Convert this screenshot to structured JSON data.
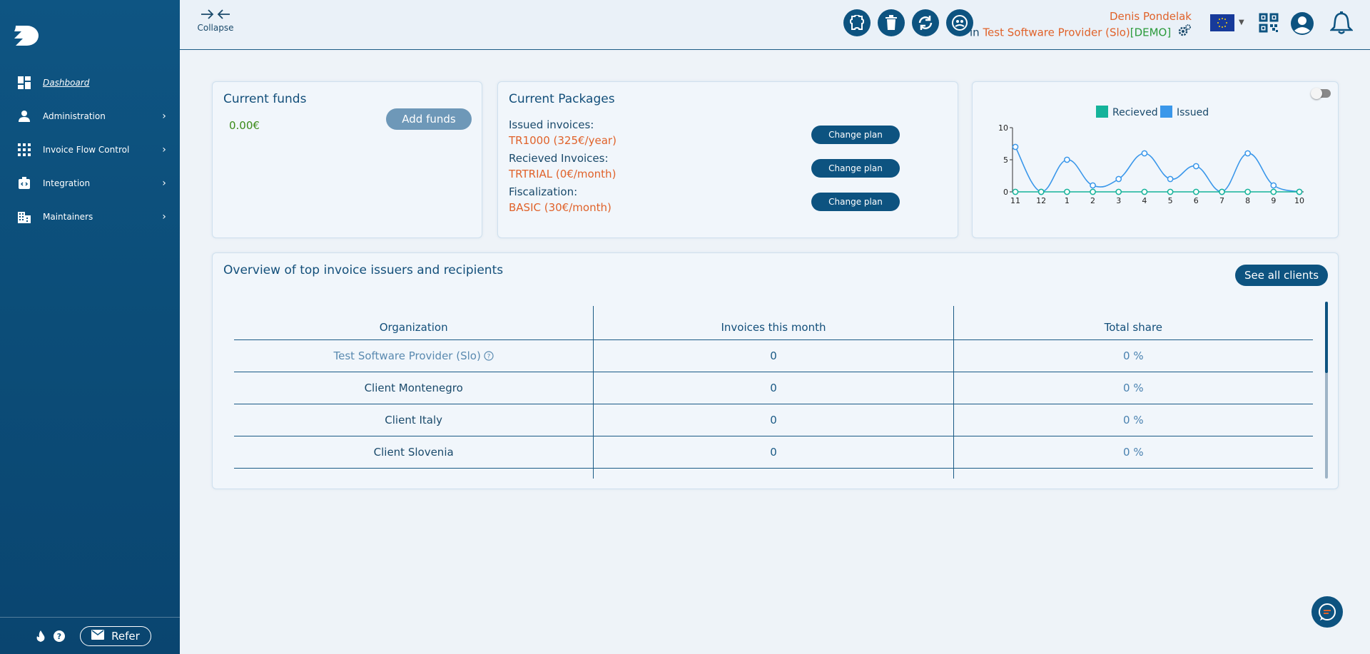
{
  "sidebar": {
    "items": [
      {
        "label": "Dashboard",
        "icon": "dashboard-icon"
      },
      {
        "label": "Administration",
        "icon": "person-icon"
      },
      {
        "label": "Invoice Flow Control",
        "icon": "grid-icon"
      },
      {
        "label": "Integration",
        "icon": "integration-icon"
      },
      {
        "label": "Maintainers",
        "icon": "building-icon"
      }
    ],
    "refer_label": "Refer"
  },
  "topbar": {
    "collapse_label": "Collapse",
    "user_name": "Denis Pondelak",
    "org_prefix": "in",
    "org_name": "Test Software Provider (Slo)",
    "org_tag": "[DEMO]"
  },
  "funds": {
    "title": "Current funds",
    "amount": "0.00€",
    "add_label": "Add funds"
  },
  "packages": {
    "title": "Current Packages",
    "items": [
      {
        "label": "Issued invoices:",
        "value": "TR1000 (325€/year)",
        "button": "Change plan"
      },
      {
        "label": "Recieved Invoices:",
        "value": "TRTRIAL (0€/month)",
        "button": "Change plan"
      },
      {
        "label": "Fiscalization:",
        "value": "BASIC (30€/month)",
        "button": "Change plan"
      }
    ]
  },
  "chart_data": {
    "type": "line",
    "categories": [
      "11",
      "12",
      "1",
      "2",
      "3",
      "4",
      "5",
      "6",
      "7",
      "8",
      "9",
      "10"
    ],
    "series": [
      {
        "name": "Recieved",
        "color": "#15b39a",
        "values": [
          0,
          0,
          0,
          0,
          0,
          0,
          0,
          0,
          0,
          0,
          0,
          0
        ]
      },
      {
        "name": "Issued",
        "color": "#3a97ea",
        "values": [
          7,
          0,
          5,
          1,
          2,
          6,
          2,
          4,
          0,
          6,
          1,
          0
        ]
      }
    ],
    "yticks": [
      0,
      5,
      10
    ],
    "ylim": [
      0,
      10
    ],
    "legend": "top"
  },
  "overview": {
    "title": "Overview of top invoice issuers and recipients",
    "see_all_label": "See all clients",
    "columns": [
      "Organization",
      "Invoices this month",
      "Total share"
    ],
    "rows": [
      {
        "org": "Test Software Provider (Slo)",
        "invoices": "0",
        "share": "0 %"
      },
      {
        "org": "Client Montenegro",
        "invoices": "0",
        "share": "0 %"
      },
      {
        "org": "Client Italy",
        "invoices": "0",
        "share": "0 %"
      },
      {
        "org": "Client Slovenia",
        "invoices": "0",
        "share": "0 %"
      }
    ]
  }
}
